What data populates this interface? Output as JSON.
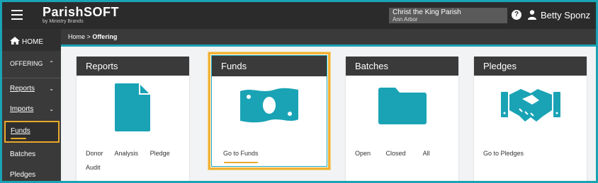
{
  "header": {
    "logo_main": "ParishSOFT",
    "logo_sub": "by Ministry Brands",
    "parish_name": "Christ the King Parish",
    "parish_city": "Ann Arbor",
    "help_label": "?",
    "user_name": "Betty Sponz"
  },
  "sidebar": {
    "home_label": "HOME",
    "section_label": "OFFERING",
    "items": [
      {
        "label": "Reports",
        "has_chevron": true
      },
      {
        "label": "Imports",
        "has_chevron": true
      },
      {
        "label": "Funds",
        "active": true
      },
      {
        "label": "Batches"
      },
      {
        "label": "Pledges"
      }
    ]
  },
  "breadcrumb": {
    "home": "Home",
    "separator": ">",
    "current": "Offering"
  },
  "cards": {
    "reports": {
      "title": "Reports",
      "links": [
        "Donor",
        "Analysis",
        "Pledge",
        "Audit"
      ],
      "icon": "document-icon"
    },
    "funds": {
      "title": "Funds",
      "links": [
        "Go to Funds"
      ],
      "icon": "money-icon"
    },
    "batches": {
      "title": "Batches",
      "links": [
        "Open",
        "Closed",
        "All"
      ],
      "icon": "folder-icon"
    },
    "pledges": {
      "title": "Pledges",
      "links": [
        "Go to Pledges"
      ],
      "icon": "handshake-icon"
    }
  },
  "colors": {
    "accent": "#1aa3b5",
    "highlight": "#f0b133",
    "dark": "#2b2b2b"
  }
}
